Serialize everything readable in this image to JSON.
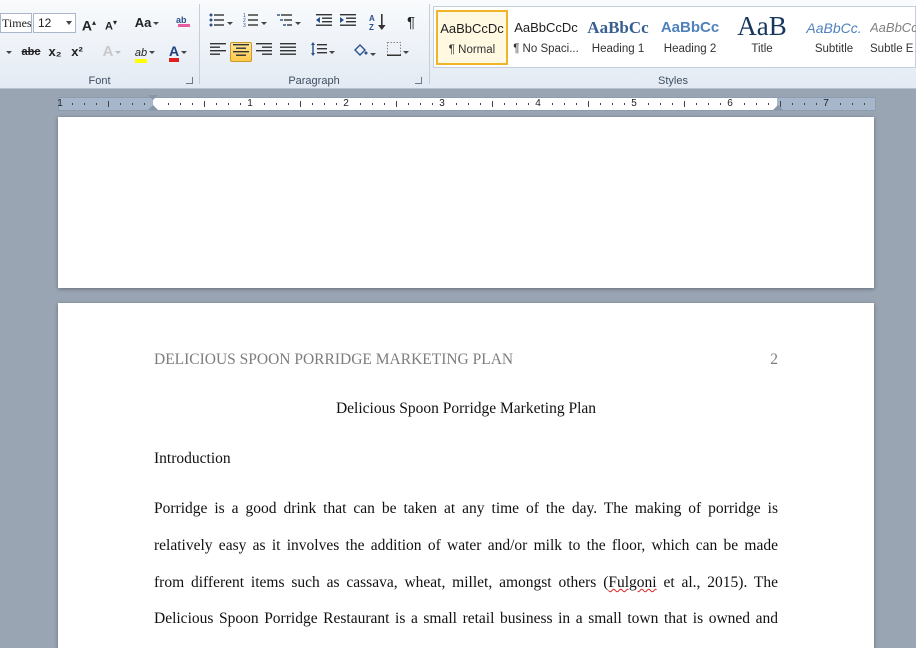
{
  "font_group": {
    "font_name": "Times New Roman",
    "font_size": "12",
    "label": "Font",
    "grow_label": "A",
    "shrink_label": "A",
    "change_case_label": "Aa",
    "bold_strike_label": "abc",
    "subscript_label": "x₂",
    "superscript_label": "x²",
    "text_effects_label": "A",
    "highlight_label": "ab",
    "font_color_label": "A"
  },
  "paragraph_group": {
    "label": "Paragraph",
    "show_marks_label": "¶"
  },
  "styles_group": {
    "label": "Styles",
    "items": [
      {
        "preview": "AaBbCcDc",
        "name": "¶ Normal"
      },
      {
        "preview": "AaBbCcDc",
        "name": "¶ No Spaci..."
      },
      {
        "preview": "AaBbCc",
        "name": "Heading 1"
      },
      {
        "preview": "AaBbCc",
        "name": "Heading 2"
      },
      {
        "preview": "AaB",
        "name": "Title"
      },
      {
        "preview": "AaBbCc.",
        "name": "Subtitle"
      },
      {
        "preview": "AaBbCcI",
        "name": "Subtle E"
      }
    ]
  },
  "ruler": {
    "numbers": [
      "1",
      "1",
      "2",
      "3",
      "4",
      "5",
      "6",
      "7"
    ]
  },
  "document": {
    "header_text": "DELICIOUS SPOON PORRIDGE MARKETING PLAN",
    "page_number": "2",
    "title": "Delicious Spoon Porridge Marketing Plan",
    "section_heading": "Introduction",
    "lines": [
      "Porridge is a good drink that can be taken at any time of the day. The making of porridge is",
      "relatively easy as it involves the addition of water and/or milk to the floor, which can be made",
      "Delicious Spoon Porridge Restaurant is a small retail business in a small town that is owned and"
    ],
    "line3_before": "from different items such as cassava, wheat, millet, amongst others (",
    "line3_spell": "Fulgoni",
    "line3_after": " et al., 2015). The"
  }
}
